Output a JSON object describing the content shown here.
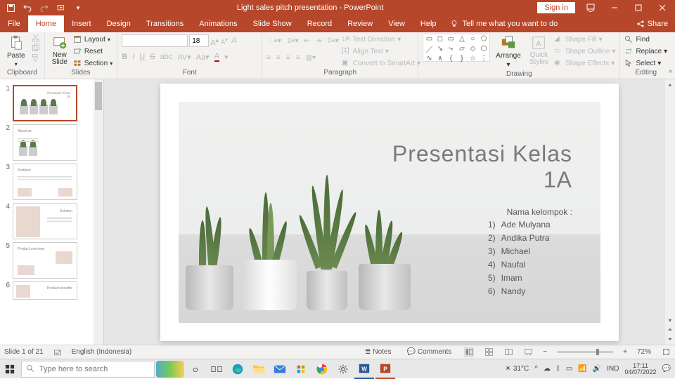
{
  "titlebar": {
    "title": "Light sales pitch presentation - PowerPoint",
    "signin": "Sign in"
  },
  "tabs": {
    "file": "File",
    "home": "Home",
    "insert": "Insert",
    "design": "Design",
    "transitions": "Transitions",
    "animations": "Animations",
    "slideshow": "Slide Show",
    "record": "Record",
    "review": "Review",
    "view": "View",
    "help": "Help",
    "tell": "Tell me what you want to do",
    "share": "Share"
  },
  "ribbon": {
    "clipboard": {
      "label": "Clipboard",
      "paste": "Paste"
    },
    "slides": {
      "label": "Slides",
      "newslide": "New\nSlide",
      "layout": "Layout",
      "reset": "Reset",
      "section": "Section"
    },
    "font": {
      "label": "Font",
      "name": "",
      "size": "18"
    },
    "paragraph": {
      "label": "Paragraph",
      "textdir": "Text Direction",
      "align": "Align Text",
      "smartart": "Convert to SmartArt"
    },
    "drawing": {
      "label": "Drawing",
      "arrange": "Arrange",
      "quick": "Quick\nStyles",
      "fill": "Shape Fill",
      "outline": "Shape Outline",
      "effects": "Shape Effects"
    },
    "editing": {
      "label": "Editing",
      "find": "Find",
      "replace": "Replace",
      "select": "Select"
    }
  },
  "thumbs": {
    "items": [
      {
        "n": "1"
      },
      {
        "n": "2"
      },
      {
        "n": "3"
      },
      {
        "n": "4"
      },
      {
        "n": "5"
      },
      {
        "n": "6"
      }
    ]
  },
  "slide": {
    "title_line1": "Presentasi Kelas",
    "title_line2": "1A",
    "subtitle": "Nama kelompok :",
    "members": [
      {
        "n": "1)",
        "name": "Ade Mulyana"
      },
      {
        "n": "2)",
        "name": "Andika Putra"
      },
      {
        "n": "3)",
        "name": "Michael"
      },
      {
        "n": "4)",
        "name": "Naufal"
      },
      {
        "n": "5)",
        "name": "Imam"
      },
      {
        "n": "6)",
        "name": "Nandy"
      }
    ]
  },
  "statusbar": {
    "slide": "Slide 1 of 21",
    "lang": "English (Indonesia)",
    "notes": "Notes",
    "comments": "Comments",
    "zoom": "72%"
  },
  "taskbar": {
    "search": "Type here to search",
    "weather": "31°C",
    "lang": "IND",
    "time": "17:11",
    "date": "04/07/2022"
  }
}
